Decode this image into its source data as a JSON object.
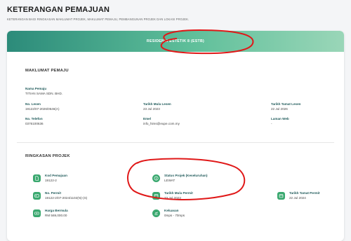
{
  "header": {
    "title": "KETERANGAN PEMAJUAN",
    "subtitle": "KETERANGAN BAGI RINGKASAN MAKLUMAT PROJEK, MAKLUMAT PEMAJU, PEMBANGUNAN PROJEK DAN LOKASI PROJEK."
  },
  "card": {
    "band_title": "RESIDENSI ESTETIK 8 (ESTB)"
  },
  "developer": {
    "section_title": "MAKLUMAT PEMAJU",
    "name_label": "Nama Pemaju",
    "name_value": "TITIAN SAMA SDN. BHD.",
    "license_label": "No. Lesen",
    "license_value": "19122/07-2026/0546(A)",
    "license_start_label": "Tarikh Mula Lesen",
    "license_start_value": "23 Jul 2023",
    "license_end_label": "Tarikh Tamat Lesen",
    "license_end_value": "22 Jul 2026",
    "phone_label": "No. Telefon",
    "phone_value": "0376100636",
    "email_label": "Emel",
    "email_value": "info_hims@eupe.com.my",
    "website_label": "Laman Web",
    "website_value": "-"
  },
  "project": {
    "section_title": "RINGKASAN PROJEK",
    "code_label": "Kod Pemajuan",
    "code_value": "19122-2",
    "status_label": "Status Projek (Keseluruhan)",
    "status_value": "LEWAT",
    "permit_label": "No. Permit",
    "permit_value": "19122-2/07-2024/1102(N)-(S)",
    "permit_start_label": "Tarikh Mula Permit",
    "permit_start_value": "23 Jul 2023",
    "permit_end_label": "Tarikh Tamat Permit",
    "permit_end_value": "22 Jul 2024",
    "price_label": "Harga Bermula",
    "price_value": "RM 569,000.00",
    "width_label": "Keluasan",
    "width_value": "0mps - 70mps"
  },
  "icons": {
    "code": "document-icon",
    "status": "info-icon",
    "permit": "id-card-icon",
    "permit_start": "calendar-icon",
    "permit_end": "calendar-icon",
    "price": "money-icon",
    "area": "area-icon"
  },
  "colors": {
    "accent": "#3aa86f",
    "band_start": "#2c8b7a",
    "band_end": "#9ad6b8",
    "annotation": "#e01818"
  }
}
